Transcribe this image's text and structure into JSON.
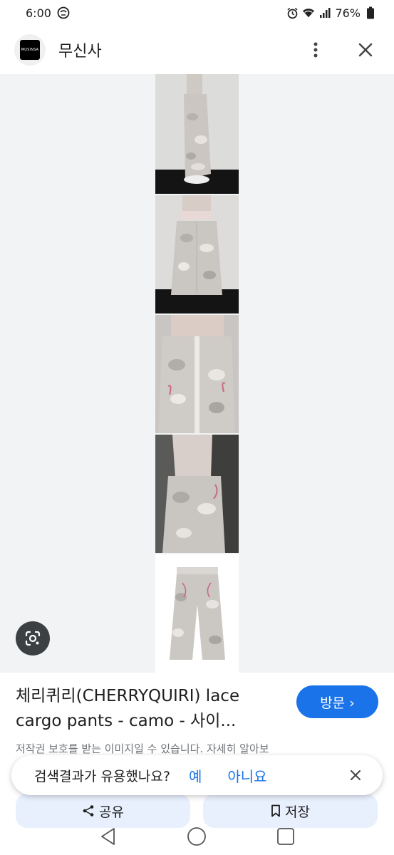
{
  "status_bar": {
    "time": "6:00",
    "battery": "76%",
    "icons": [
      "alarm-icon",
      "wifi-icon",
      "signal-icon",
      "battery-icon"
    ]
  },
  "header": {
    "logo_text": "MUSINSA",
    "site_name": "무신사",
    "icons": [
      "more-vert-icon",
      "close-icon"
    ]
  },
  "result": {
    "title": "체리퀴리(CHERRYQUIRI) lace cargo pants - camo - 사이...",
    "visit_label": "방문 ›",
    "copyright_note": "저작권 보호를 받는 이미지일 수 있습니다. 자세히 알아보"
  },
  "feedback": {
    "question": "검색결과가 유용했나요?",
    "yes": "예",
    "no": "아니요"
  },
  "actions": {
    "share_label": "공유",
    "save_label": "저장"
  },
  "colors": {
    "accent": "#1a73e8",
    "pill_bg": "#e8f0fe",
    "image_bg": "#f1f3f4"
  }
}
